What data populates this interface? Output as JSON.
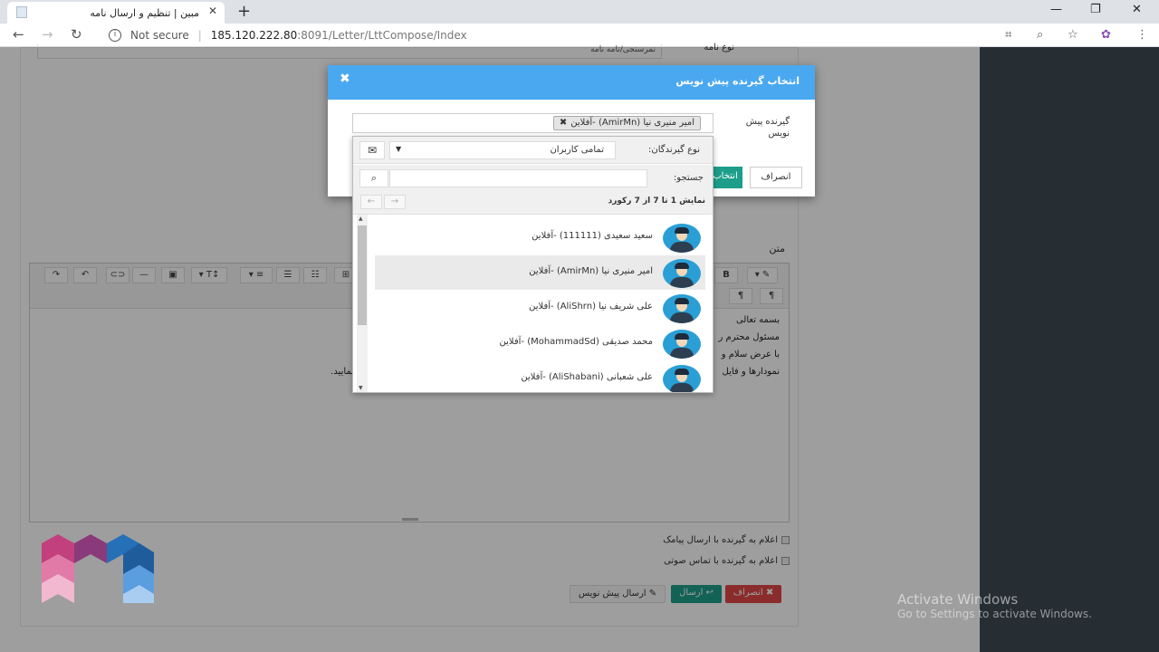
{
  "browser": {
    "tab_title": "مبین | تنظیم و ارسال نامه",
    "tab_close": "✕",
    "new_tab": "+",
    "security_label": "Not secure",
    "url_host": "185.120.222.80",
    "url_path": ":8091/Letter/LttCompose/Index",
    "window_controls": [
      "—",
      "❐",
      "✕"
    ]
  },
  "form": {
    "label_text": "متن",
    "field_top_value": "نمرسنجی/نامه نامه",
    "field_top_label": "نوع نامه",
    "editor_lines": [
      "بسمه تعالی",
      "مسئول محترم ر",
      "با عرض سلام و",
      "نمودارها و فایل",
      "نمایید."
    ],
    "checkbox_sms": "اعلام به گیرنده با ارسال پیامک",
    "checkbox_call": "اعلام به گیرنده با تماس صوتی",
    "btn_draft": "ارسال پیش نویس",
    "btn_send": "ارسال",
    "btn_cancel": "انصراف"
  },
  "modal": {
    "title": "انتخاب گیرنده پیش نویس",
    "close": "✖",
    "field_label": "گیرنده پیش نویس",
    "selected_chip": "امیر منیری نیا (AmirMn) -آفلاین",
    "chip_remove": "✖",
    "cancel_label": "انصراف",
    "ok_label": "انتخاب"
  },
  "dropdown": {
    "type_label": "نوع گیرندگان:",
    "type_value": "تمامی کاربران",
    "search_label": "جستجو:",
    "search_value": "",
    "pager_info": "نمایش 1 تا 7 از 7 رکورد",
    "items": [
      {
        "name": "سعید سعیدی (111111) -آفلاین"
      },
      {
        "name": "امیر منیری نیا (AmirMn) -آفلاین"
      },
      {
        "name": "علی شریف نیا (AliShrn) -آفلاین"
      },
      {
        "name": "محمد صدیقی (MohammadSd) -آفلاین"
      },
      {
        "name": "علی شعبانی (AliShabani) -آفلاین"
      }
    ],
    "selected_index": 1
  },
  "watermark": {
    "line1": "Activate Windows",
    "line2": "Go to Settings to activate Windows."
  },
  "colors": {
    "modal_header": "#4aa8f0",
    "ok_button": "#1d9e8a",
    "send_button": "#1d9e8a",
    "cancel_button": "#e04848",
    "avatar": "#2a9fd6"
  }
}
